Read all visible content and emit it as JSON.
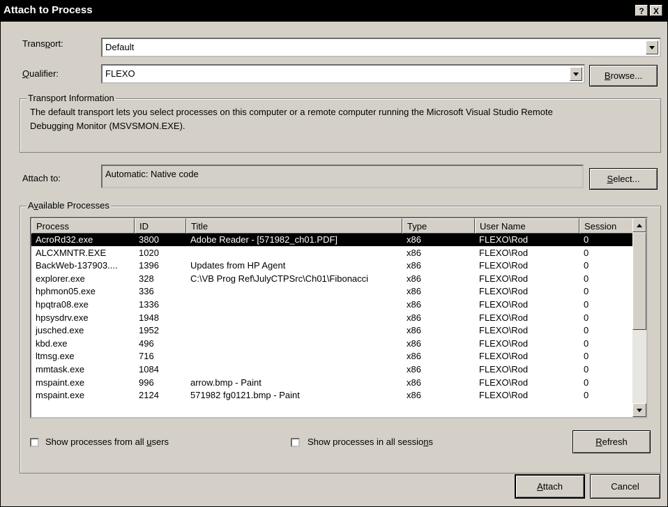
{
  "window": {
    "title": "Attach to Process",
    "help_label": "?",
    "close_label": "X"
  },
  "transport": {
    "label_pre": "Trans",
    "label_ul": "p",
    "label_post": "ort:",
    "value": "Default"
  },
  "qualifier": {
    "label_ul": "Q",
    "label_post": "ualifier:",
    "value": "FLEXO",
    "browse_ul": "B",
    "browse_post": "rowse..."
  },
  "transport_info": {
    "legend": "Transport Information",
    "line1": "The default transport lets you select processes on this computer or a remote computer running the Microsoft Visual Studio Remote",
    "line2": "Debugging Monitor (MSVSMON.EXE)."
  },
  "attach_to": {
    "label": "Attach to:",
    "value": "Automatic: Native code",
    "select_ul": "S",
    "select_post": "elect..."
  },
  "available": {
    "legend_pre": "A",
    "legend_ul": "v",
    "legend_post": "ailable Processes",
    "columns": [
      "Process",
      "ID",
      "Title",
      "Type",
      "User Name",
      "Session"
    ],
    "rows": [
      {
        "process": "AcroRd32.exe",
        "id": "3800",
        "title": "Adobe Reader - [571982_ch01.PDF]",
        "type": "x86",
        "user": "FLEXO\\Rod",
        "session": "0"
      },
      {
        "process": "ALCXMNTR.EXE",
        "id": "1020",
        "title": "",
        "type": "x86",
        "user": "FLEXO\\Rod",
        "session": "0"
      },
      {
        "process": "BackWeb-137903....",
        "id": "1396",
        "title": "Updates from HP Agent",
        "type": "x86",
        "user": "FLEXO\\Rod",
        "session": "0"
      },
      {
        "process": "explorer.exe",
        "id": "328",
        "title": "C:\\VB Prog Ref\\JulyCTPSrc\\Ch01\\Fibonacci",
        "type": "x86",
        "user": "FLEXO\\Rod",
        "session": "0"
      },
      {
        "process": "hphmon05.exe",
        "id": "336",
        "title": "",
        "type": "x86",
        "user": "FLEXO\\Rod",
        "session": "0"
      },
      {
        "process": "hpqtra08.exe",
        "id": "1336",
        "title": "",
        "type": "x86",
        "user": "FLEXO\\Rod",
        "session": "0"
      },
      {
        "process": "hpsysdrv.exe",
        "id": "1948",
        "title": "",
        "type": "x86",
        "user": "FLEXO\\Rod",
        "session": "0"
      },
      {
        "process": "jusched.exe",
        "id": "1952",
        "title": "",
        "type": "x86",
        "user": "FLEXO\\Rod",
        "session": "0"
      },
      {
        "process": "kbd.exe",
        "id": "496",
        "title": "",
        "type": "x86",
        "user": "FLEXO\\Rod",
        "session": "0"
      },
      {
        "process": "ltmsg.exe",
        "id": "716",
        "title": "",
        "type": "x86",
        "user": "FLEXO\\Rod",
        "session": "0"
      },
      {
        "process": "mmtask.exe",
        "id": "1084",
        "title": "",
        "type": "x86",
        "user": "FLEXO\\Rod",
        "session": "0"
      },
      {
        "process": "mspaint.exe",
        "id": "996",
        "title": "arrow.bmp - Paint",
        "type": "x86",
        "user": "FLEXO\\Rod",
        "session": "0"
      },
      {
        "process": "mspaint.exe",
        "id": "2124",
        "title": "571982 fg0121.bmp - Paint",
        "type": "x86",
        "user": "FLEXO\\Rod",
        "session": "0"
      }
    ]
  },
  "options": {
    "all_users_pre": "Show processes from all ",
    "all_users_ul": "u",
    "all_users_post": "sers",
    "all_sessions_pre": "Show processes in all sessio",
    "all_sessions_ul": "n",
    "all_sessions_post": "s",
    "refresh_ul": "R",
    "refresh_post": "efresh"
  },
  "footer": {
    "attach_ul": "A",
    "attach_post": "ttach",
    "cancel": "Cancel"
  }
}
